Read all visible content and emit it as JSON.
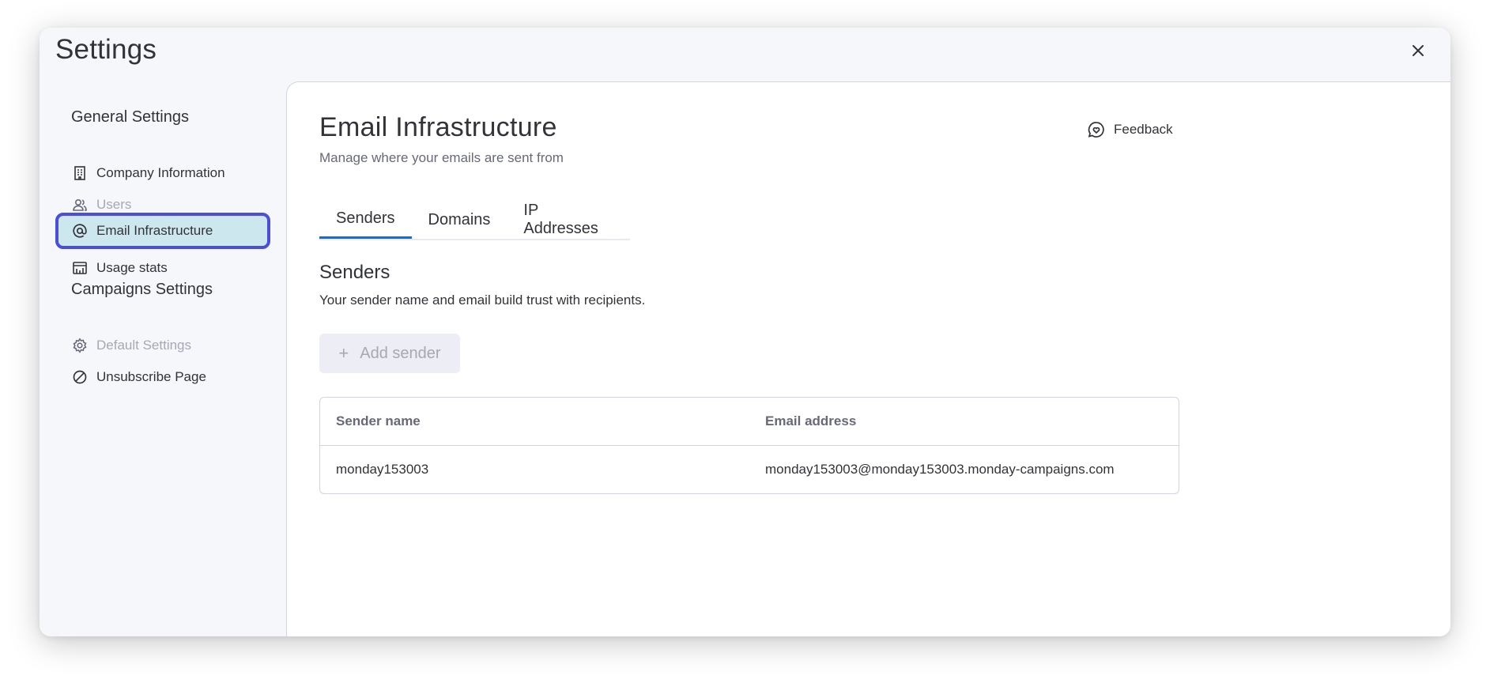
{
  "dialog": {
    "title": "Settings"
  },
  "sidebar": {
    "general_title": "General Settings",
    "general_items": [
      {
        "label": "Company Information",
        "icon": "building-icon",
        "state": "normal"
      },
      {
        "label": "Users",
        "icon": "users-icon",
        "state": "disabled"
      },
      {
        "label": "Email Infrastructure",
        "icon": "at-sign-icon",
        "state": "active"
      },
      {
        "label": "Usage stats",
        "icon": "usage-stats-icon",
        "state": "normal"
      }
    ],
    "campaigns_title": "Campaigns Settings",
    "campaigns_items": [
      {
        "label": "Default Settings",
        "icon": "gear-icon",
        "state": "disabled"
      },
      {
        "label": "Unsubscribe Page",
        "icon": "prohibited-icon",
        "state": "normal"
      }
    ]
  },
  "main": {
    "title": "Email Infrastructure",
    "subtitle": "Manage where your emails are sent from",
    "feedback_label": "Feedback",
    "tabs": [
      {
        "label": "Senders",
        "active": true
      },
      {
        "label": "Domains",
        "active": false
      },
      {
        "label": "IP Addresses",
        "active": false
      }
    ],
    "section_title": "Senders",
    "section_desc": "Your sender name and email build trust with recipients.",
    "add_button_label": "Add sender",
    "table": {
      "columns": [
        "Sender name",
        "Email address"
      ],
      "rows": [
        [
          "monday153003",
          "monday153003@monday153003.monday-campaigns.com"
        ]
      ]
    }
  },
  "colors": {
    "accent": "#0073ea",
    "selection_outline": "#4b4ddb",
    "selection_fill": "#cce8ee"
  }
}
